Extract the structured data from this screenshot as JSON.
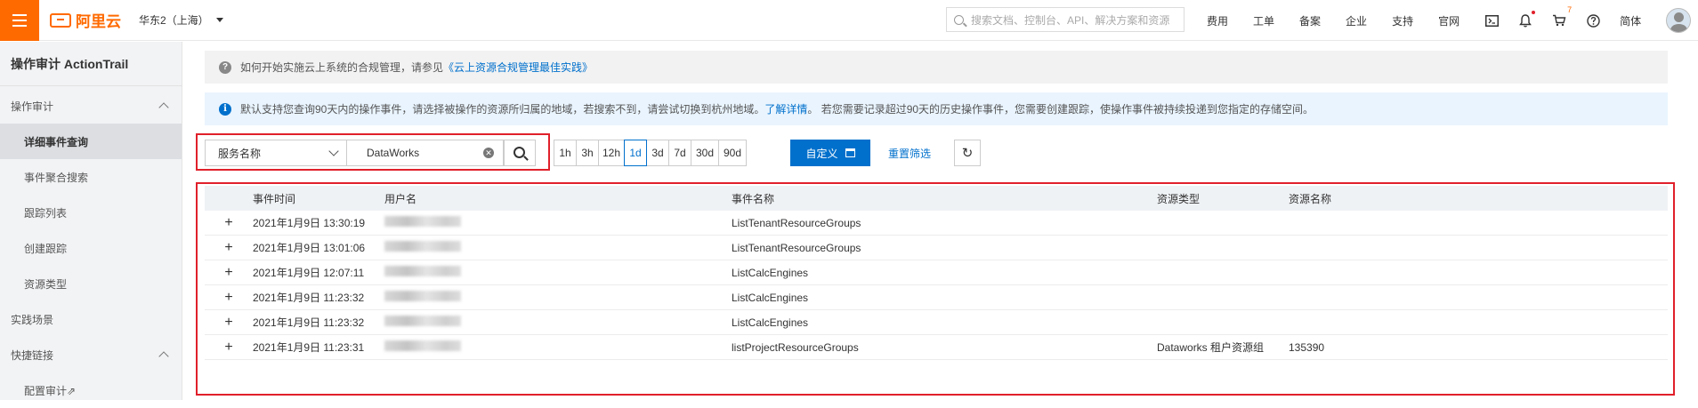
{
  "header": {
    "logo_text": "阿里云",
    "region": "华东2（上海）",
    "search_placeholder": "搜索文档、控制台、API、解决方案和资源",
    "links": [
      "费用",
      "工单",
      "备案",
      "企业",
      "支持",
      "官网"
    ],
    "notification_count": "7",
    "language": "简体"
  },
  "sidebar": {
    "title": "操作审计 ActionTrail",
    "section1": "操作审计",
    "items": [
      "详细事件查询",
      "事件聚合搜索",
      "跟踪列表",
      "创建跟踪",
      "资源类型"
    ],
    "section2": "实践场景",
    "section3": "快捷链接",
    "link1": "配置审计⇗"
  },
  "tips": {
    "compliance_text": "如何开始实施云上系统的合规管理，请参见",
    "compliance_link": "《云上资源合规管理最佳实践》",
    "info_text1": "默认支持您查询90天内的操作事件，请选择被操作的资源所归属的地域，若搜索不到，请尝试切换到杭州地域。",
    "info_link": "了解详情",
    "info_text2": "。 若您需要记录超过90天的历史操作事件，您需要创建跟踪，使操作事件被持续投递到您指定的存储空间。"
  },
  "filters": {
    "service_label": "服务名称",
    "service_value": "DataWorks",
    "time_options": [
      "1h",
      "3h",
      "12h",
      "1d",
      "3d",
      "7d",
      "30d",
      "90d"
    ],
    "selected_time": "1d",
    "custom_label": "自定义",
    "reset_label": "重置筛选"
  },
  "table": {
    "headers": [
      "事件时间",
      "用户名",
      "事件名称",
      "资源类型",
      "资源名称"
    ],
    "rows": [
      {
        "time": "2021年1月9日 13:30:19",
        "event": "ListTenantResourceGroups",
        "rtype": "",
        "rname": ""
      },
      {
        "time": "2021年1月9日 13:01:06",
        "event": "ListTenantResourceGroups",
        "rtype": "",
        "rname": ""
      },
      {
        "time": "2021年1月9日 12:07:11",
        "event": "ListCalcEngines",
        "rtype": "",
        "rname": ""
      },
      {
        "time": "2021年1月9日 11:23:32",
        "event": "ListCalcEngines",
        "rtype": "",
        "rname": ""
      },
      {
        "time": "2021年1月9日 11:23:32",
        "event": "ListCalcEngines",
        "rtype": "",
        "rname": ""
      },
      {
        "time": "2021年1月9日 11:23:31",
        "event": "listProjectResourceGroups",
        "rtype": "Dataworks 租户资源组",
        "rname": "135390"
      }
    ]
  },
  "colors": {
    "accent": "#ff6a00",
    "primary": "#0070cc",
    "highlight": "#e0202b"
  }
}
